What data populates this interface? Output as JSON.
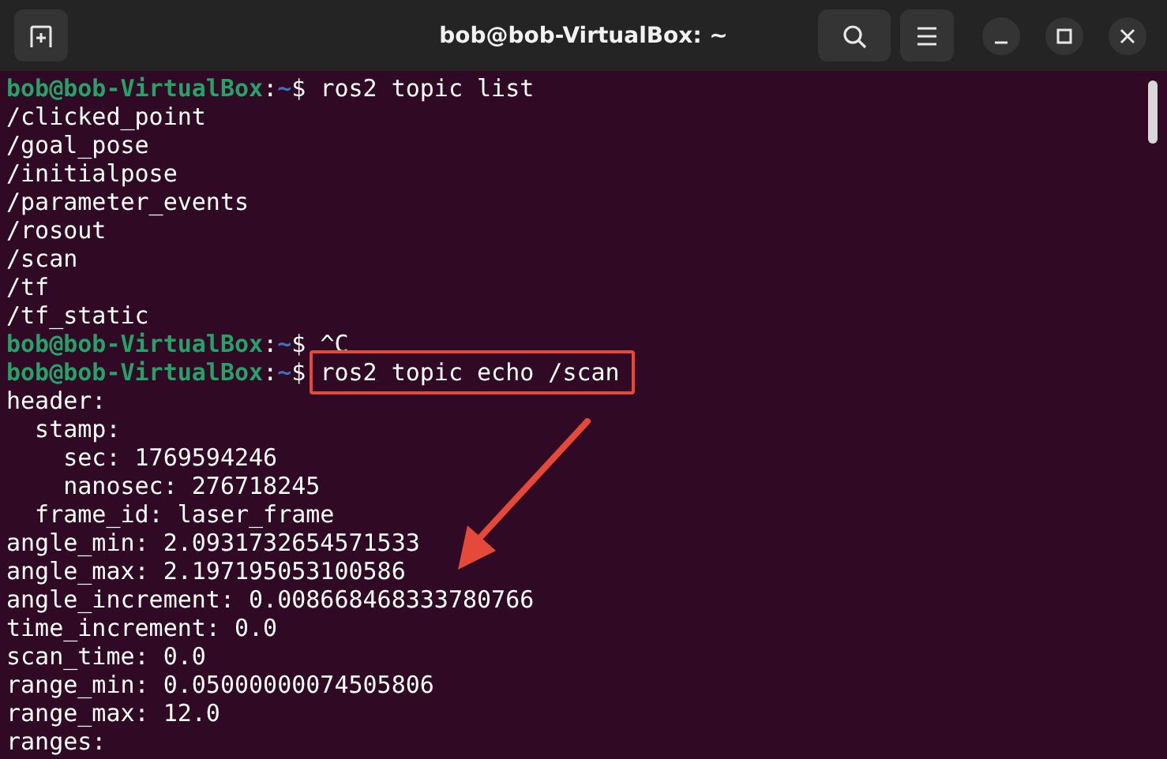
{
  "window": {
    "title": "bob@bob-VirtualBox: ~"
  },
  "lines": [
    {
      "kind": "prompt",
      "user_host": "bob@bob-VirtualBox",
      "separator": ":",
      "path": "~",
      "symbol": "$",
      "command": "ros2 topic list",
      "highlighted": false
    },
    {
      "kind": "output",
      "text": "/clicked_point"
    },
    {
      "kind": "output",
      "text": "/goal_pose"
    },
    {
      "kind": "output",
      "text": "/initialpose"
    },
    {
      "kind": "output",
      "text": "/parameter_events"
    },
    {
      "kind": "output",
      "text": "/rosout"
    },
    {
      "kind": "output",
      "text": "/scan"
    },
    {
      "kind": "output",
      "text": "/tf"
    },
    {
      "kind": "output",
      "text": "/tf_static"
    },
    {
      "kind": "prompt",
      "user_host": "bob@bob-VirtualBox",
      "separator": ":",
      "path": "~",
      "symbol": "$",
      "command": "^C",
      "highlighted": false
    },
    {
      "kind": "prompt",
      "user_host": "bob@bob-VirtualBox",
      "separator": ":",
      "path": "~",
      "symbol": "$",
      "command": "ros2 topic echo /scan",
      "highlighted": true
    },
    {
      "kind": "output",
      "text": "header:"
    },
    {
      "kind": "output",
      "text": "  stamp:"
    },
    {
      "kind": "output",
      "text": "    sec: 1769594246"
    },
    {
      "kind": "output",
      "text": "    nanosec: 276718245"
    },
    {
      "kind": "output",
      "text": "  frame_id: laser_frame"
    },
    {
      "kind": "output",
      "text": "angle_min: 2.0931732654571533"
    },
    {
      "kind": "output",
      "text": "angle_max: 2.197195053100586"
    },
    {
      "kind": "output",
      "text": "angle_increment: 0.008668468333780766"
    },
    {
      "kind": "output",
      "text": "time_increment: 0.0"
    },
    {
      "kind": "output",
      "text": "scan_time: 0.0"
    },
    {
      "kind": "output",
      "text": "range_min: 0.05000000074505806"
    },
    {
      "kind": "output",
      "text": "range_max: 12.0"
    },
    {
      "kind": "output",
      "text": "ranges:"
    }
  ]
}
